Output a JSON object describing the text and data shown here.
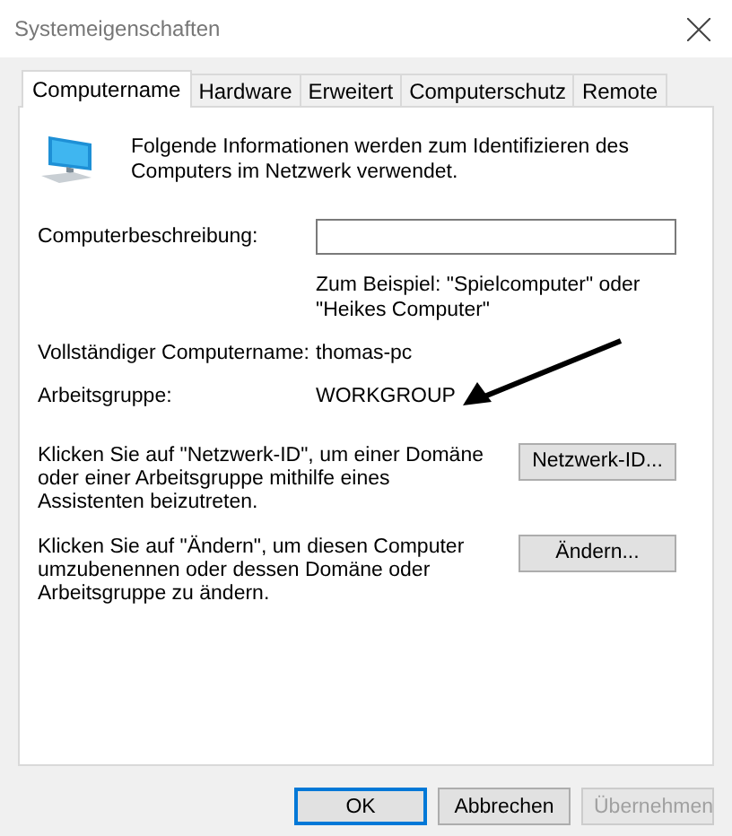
{
  "window": {
    "title": "Systemeigenschaften"
  },
  "tabs": [
    {
      "label": "Computername",
      "selected": true
    },
    {
      "label": "Hardware",
      "selected": false
    },
    {
      "label": "Erweitert",
      "selected": false
    },
    {
      "label": "Computerschutz",
      "selected": false
    },
    {
      "label": "Remote",
      "selected": false
    }
  ],
  "intro": "Folgende Informationen werden zum Identifizieren des Computers im Netzwerk verwendet.",
  "description": {
    "label": "Computerbeschreibung:",
    "hint": "Zum Beispiel: \"Spielcomputer\" oder \"Heikes Computer\""
  },
  "fields": [
    {
      "label": "Vollständiger Computername:",
      "value": "thomas-pc"
    },
    {
      "label": "Arbeitsgruppe:",
      "value": "WORKGROUP"
    }
  ],
  "actions": [
    {
      "text": "Klicken Sie auf \"Netzwerk-ID\", um einer Domäne oder einer Arbeitsgruppe mithilfe eines Assistenten beizutreten.",
      "button": "Netzwerk-ID..."
    },
    {
      "text": "Klicken Sie auf \"Ändern\", um diesen Computer umzubenennen oder dessen Domäne oder Arbeitsgruppe zu ändern.",
      "button": "Ändern..."
    }
  ],
  "buttons": [
    {
      "label": "OK",
      "default": true,
      "disabled": false
    },
    {
      "label": "Abbrechen",
      "default": false,
      "disabled": false
    },
    {
      "label": "Übernehmen",
      "default": false,
      "disabled": true
    }
  ]
}
